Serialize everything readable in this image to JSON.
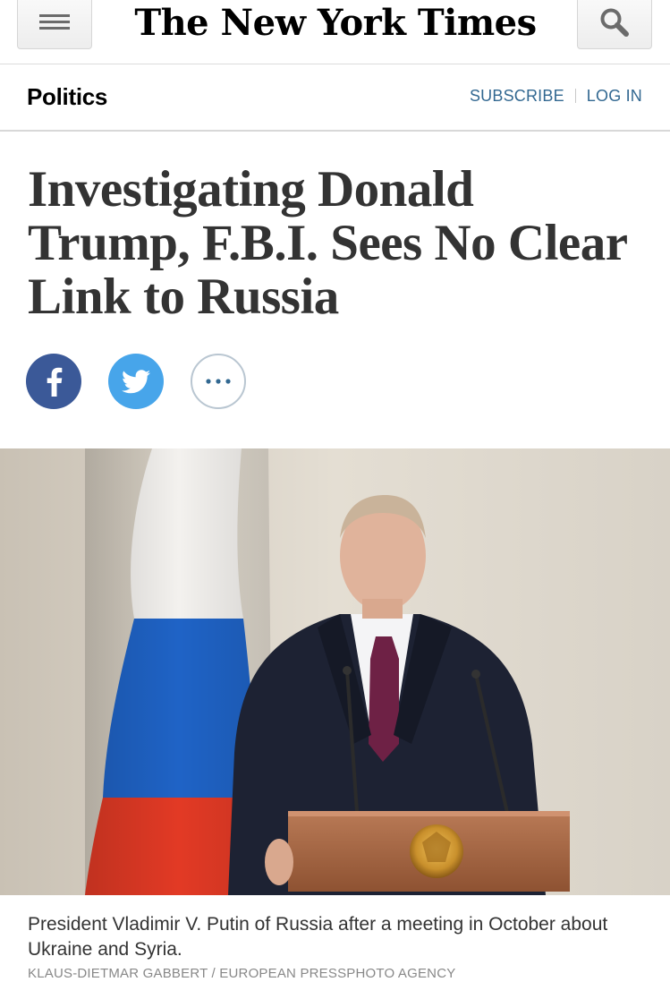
{
  "masthead": {
    "logo_text": "The New York Times",
    "menu_icon": "hamburger-menu-icon",
    "search_icon": "search-icon"
  },
  "section": {
    "name": "Politics",
    "subscribe_label": "SUBSCRIBE",
    "login_label": "LOG IN"
  },
  "article": {
    "headline": "Investigating Donald Trump, F.B.I. Sees No Clear Link to Russia"
  },
  "share": {
    "facebook_icon": "facebook-icon",
    "twitter_icon": "twitter-icon",
    "more_icon": "more-options-icon"
  },
  "photo": {
    "caption": "President Vladimir V. Putin of Russia after a meeting in October about Ukraine and Syria.",
    "credit": "KLAUS-DIETMAR GABBERT / EUROPEAN PRESSPHOTO AGENCY"
  },
  "colors": {
    "link": "#326891",
    "facebook": "#3b5998",
    "twitter": "#47a5ea",
    "headline_text": "#333333"
  }
}
